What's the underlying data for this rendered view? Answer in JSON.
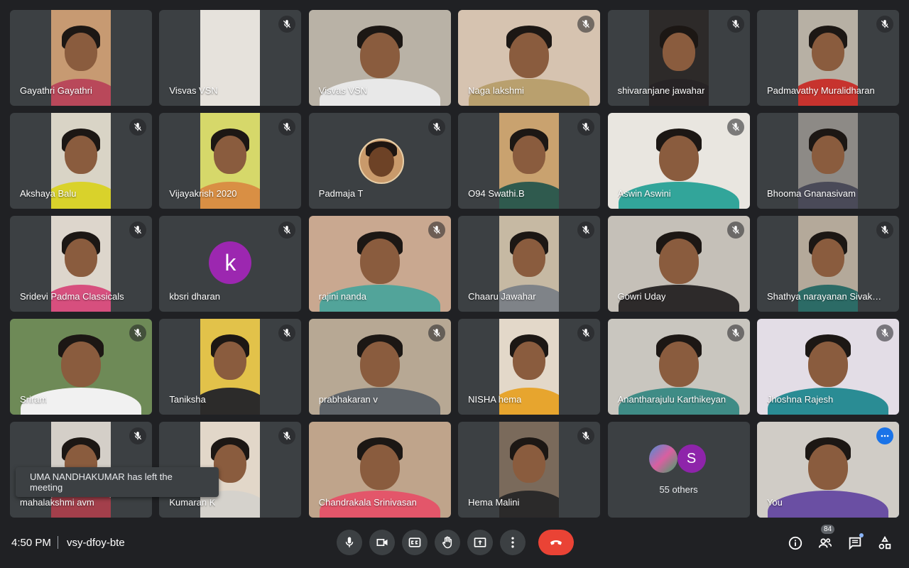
{
  "meeting": {
    "time": "4:50 PM",
    "code": "vsy-dfoy-bte",
    "participant_count": "84"
  },
  "toast": "UMA NANDHAKUMAR has left the meeting",
  "tiles": [
    {
      "name": "Gayathri Gayathri",
      "muted": false,
      "kind": "video",
      "bg": "#c79a72",
      "shirt": "#b9485a"
    },
    {
      "name": "Visvas VSN",
      "muted": true,
      "kind": "video",
      "bg": "#e6e2dc",
      "shirt": "#d9d4cc",
      "empty": true
    },
    {
      "name": "Visvas VSN",
      "muted": false,
      "kind": "wide",
      "bg": "#b9b2a6",
      "shirt": "#e8e8e8"
    },
    {
      "name": "Naga lakshmi",
      "muted": true,
      "kind": "wide",
      "bg": "#d6c3b0",
      "shirt": "#b9a06e"
    },
    {
      "name": "shivaranjane jawahar",
      "muted": true,
      "kind": "video",
      "bg": "#2d2a29",
      "shirt": "#272325"
    },
    {
      "name": "Padmavathy Muralidharan",
      "muted": true,
      "kind": "video",
      "bg": "#b7b0a4",
      "shirt": "#c7332e"
    },
    {
      "name": "Akshaya Balu",
      "muted": true,
      "kind": "video",
      "bg": "#d9d4c6",
      "shirt": "#d9d22b"
    },
    {
      "name": "Vijayakrish 2020",
      "muted": true,
      "kind": "video",
      "bg": "#d6d86a",
      "shirt": "#d98f44"
    },
    {
      "name": "Padmaja T",
      "muted": true,
      "kind": "photo"
    },
    {
      "name": "O94 Swathi.B",
      "muted": true,
      "kind": "video",
      "bg": "#c9a26f",
      "shirt": "#2f5a4e"
    },
    {
      "name": "Aswin Aswini",
      "muted": true,
      "kind": "wide",
      "bg": "#e9e6e0",
      "shirt": "#32a59a"
    },
    {
      "name": "Bhooma Gnanasivam",
      "muted": false,
      "kind": "video",
      "bg": "#8d8a86",
      "shirt": "#4a4a58"
    },
    {
      "name": "Sridevi Padma Classicals",
      "muted": true,
      "kind": "video",
      "bg": "#ddd6cc",
      "shirt": "#d74f7e"
    },
    {
      "name": "kbsri dharan",
      "muted": true,
      "kind": "letter",
      "letter": "k",
      "avatar_color": "#9c27b0"
    },
    {
      "name": "rajini nanda",
      "muted": true,
      "kind": "wide",
      "bg": "#c9a890",
      "shirt": "#52a49a"
    },
    {
      "name": "Chaaru Jawahar",
      "muted": true,
      "kind": "video",
      "bg": "#c6b9a3",
      "shirt": "#7f8388"
    },
    {
      "name": "Gowri Uday",
      "muted": true,
      "kind": "wide",
      "bg": "#c5c0b8",
      "shirt": "#2d2a2a"
    },
    {
      "name": "Shathya narayanan Sivakumar",
      "muted": true,
      "kind": "video",
      "bg": "#b4a99a",
      "shirt": "#2c6b66"
    },
    {
      "name": "Sriram",
      "muted": true,
      "kind": "wide",
      "bg": "#6e8a57",
      "shirt": "#f1f1f1"
    },
    {
      "name": "Taniksha",
      "muted": true,
      "kind": "video",
      "bg": "#e2c24a",
      "shirt": "#2c2b2a"
    },
    {
      "name": "prabhakaran v",
      "muted": true,
      "kind": "wide",
      "bg": "#b7a894",
      "shirt": "#5f6469"
    },
    {
      "name": "NISHA hema",
      "muted": true,
      "kind": "video",
      "bg": "#e3d8c9",
      "shirt": "#e7a52e"
    },
    {
      "name": "Anantharajulu Karthikeyan",
      "muted": true,
      "kind": "wide",
      "bg": "#c9c6bf",
      "shirt": "#3f8c86"
    },
    {
      "name": "Jhoshna Rajesh",
      "muted": true,
      "kind": "wide",
      "bg": "#e3dde6",
      "shirt": "#2a8c94"
    },
    {
      "name": "mahalakshmi avm",
      "muted": true,
      "kind": "video",
      "bg": "#d4cfc8",
      "shirt": "#a33f4b"
    },
    {
      "name": "Kumaran K",
      "muted": true,
      "kind": "video",
      "bg": "#e2d7c9",
      "shirt": "#d5d2cc"
    },
    {
      "name": "Chandrakala Srinivasan",
      "muted": false,
      "kind": "wide",
      "bg": "#bfa48b",
      "shirt": "#e3566a"
    },
    {
      "name": "Hema Malini",
      "muted": true,
      "kind": "video",
      "bg": "#7a6a5b",
      "shirt": "#2b2a2a"
    },
    {
      "name": "",
      "muted": false,
      "kind": "others",
      "others_label": "55 others",
      "avatar_letter": "S"
    },
    {
      "name": "You",
      "muted": false,
      "kind": "you",
      "bg": "#d0ccc6",
      "shirt": "#6a4fa3"
    }
  ],
  "controls": {
    "mic": "microphone-icon",
    "camera": "camera-icon",
    "captions": "closed-captions-icon",
    "raise_hand": "raise-hand-icon",
    "present": "present-screen-icon",
    "more": "more-options-icon",
    "hangup": "hang-up-icon"
  },
  "colors": {
    "background": "#202124",
    "tile": "#3c4043",
    "hangup": "#ea4335",
    "self_outline": "#8ab4f8"
  }
}
